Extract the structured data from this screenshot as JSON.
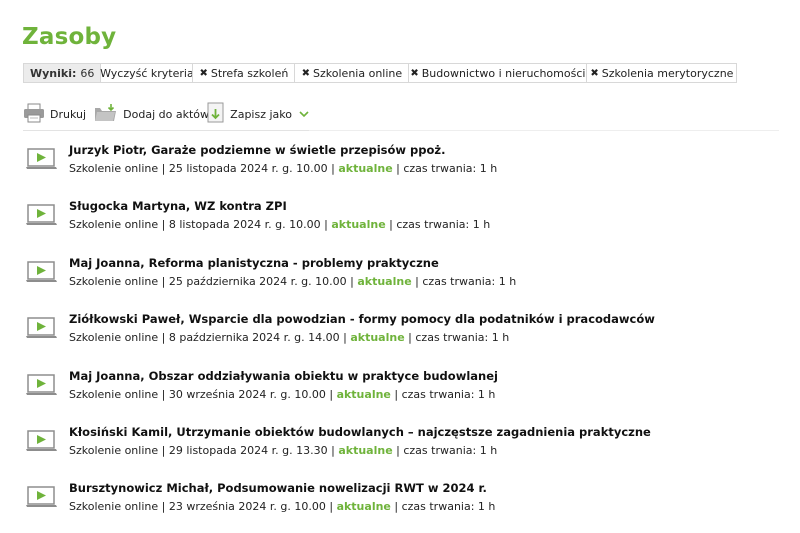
{
  "page": {
    "title": "Zasoby"
  },
  "filters": {
    "results_label": "Wyniki:",
    "results_count": "66",
    "clear_label": "Wyczyść kryteria",
    "chips": [
      "Strefa szkoleń",
      "Szkolenia online",
      "Budownictwo i nieruchomości",
      "Szkolenia merytoryczne"
    ]
  },
  "toolbar": {
    "print_label": "Drukuj",
    "folder_label": "Dodaj do aktówki",
    "save_label": "Zapisz jako"
  },
  "colors": {
    "accent": "#6fb33b"
  },
  "items": [
    {
      "title": "Jurzyk Piotr, Garaże podziemne w świetle przepisów ppoż.",
      "type": "Szkolenie online",
      "date": "25 listopada 2024 r. g. 10.00",
      "status": "aktualne",
      "duration": "czas trwania: 1 h"
    },
    {
      "title": "Sługocka Martyna, WZ kontra ZPI",
      "type": "Szkolenie online",
      "date": "8 listopada 2024 r. g. 10.00",
      "status": "aktualne",
      "duration": "czas trwania: 1 h"
    },
    {
      "title": "Maj Joanna, Reforma planistyczna - problemy praktyczne",
      "type": "Szkolenie online",
      "date": "25 października 2024 r. g. 10.00",
      "status": "aktualne",
      "duration": "czas trwania: 1 h"
    },
    {
      "title": "Ziółkowski Paweł, Wsparcie dla powodzian - formy pomocy dla podatników i pracodawców",
      "type": "Szkolenie online",
      "date": "8 października 2024 r. g. 14.00",
      "status": "aktualne",
      "duration": "czas trwania: 1 h"
    },
    {
      "title": "Maj Joanna, Obszar oddziaływania obiektu w praktyce budowlanej",
      "type": "Szkolenie online",
      "date": "30 września 2024 r. g. 10.00",
      "status": "aktualne",
      "duration": "czas trwania: 1 h"
    },
    {
      "title": "Kłosiński Kamil, Utrzymanie obiektów budowlanych – najczęstsze zagadnienia praktyczne",
      "type": "Szkolenie online",
      "date": "29 listopada 2024 r. g. 13.30",
      "status": "aktualne",
      "duration": "czas trwania: 1 h"
    },
    {
      "title": "Bursztynowicz Michał, Podsumowanie nowelizacji RWT w 2024 r.",
      "type": "Szkolenie online",
      "date": "23 września 2024 r. g. 10.00",
      "status": "aktualne",
      "duration": "czas trwania: 1 h"
    }
  ]
}
